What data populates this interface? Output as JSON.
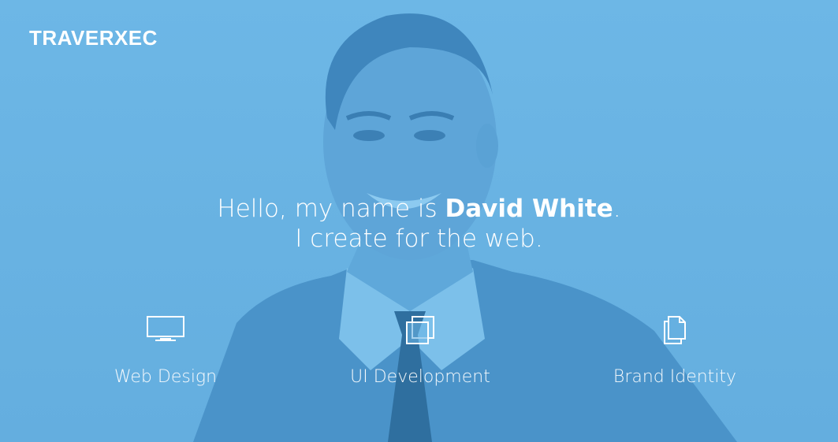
{
  "brand": {
    "logo": "TRAVERXEC"
  },
  "hero": {
    "line1_prefix": "Hello, my name is ",
    "line1_name": "David White",
    "line1_suffix": ".",
    "line2": "I create for the web.",
    "overlay_color": "#6ab4e4"
  },
  "services": [
    {
      "label": "Web Design",
      "icon": "monitor-icon"
    },
    {
      "label": "UI Development",
      "icon": "layers-icon"
    },
    {
      "label": "Brand Identity",
      "icon": "documents-icon"
    }
  ]
}
